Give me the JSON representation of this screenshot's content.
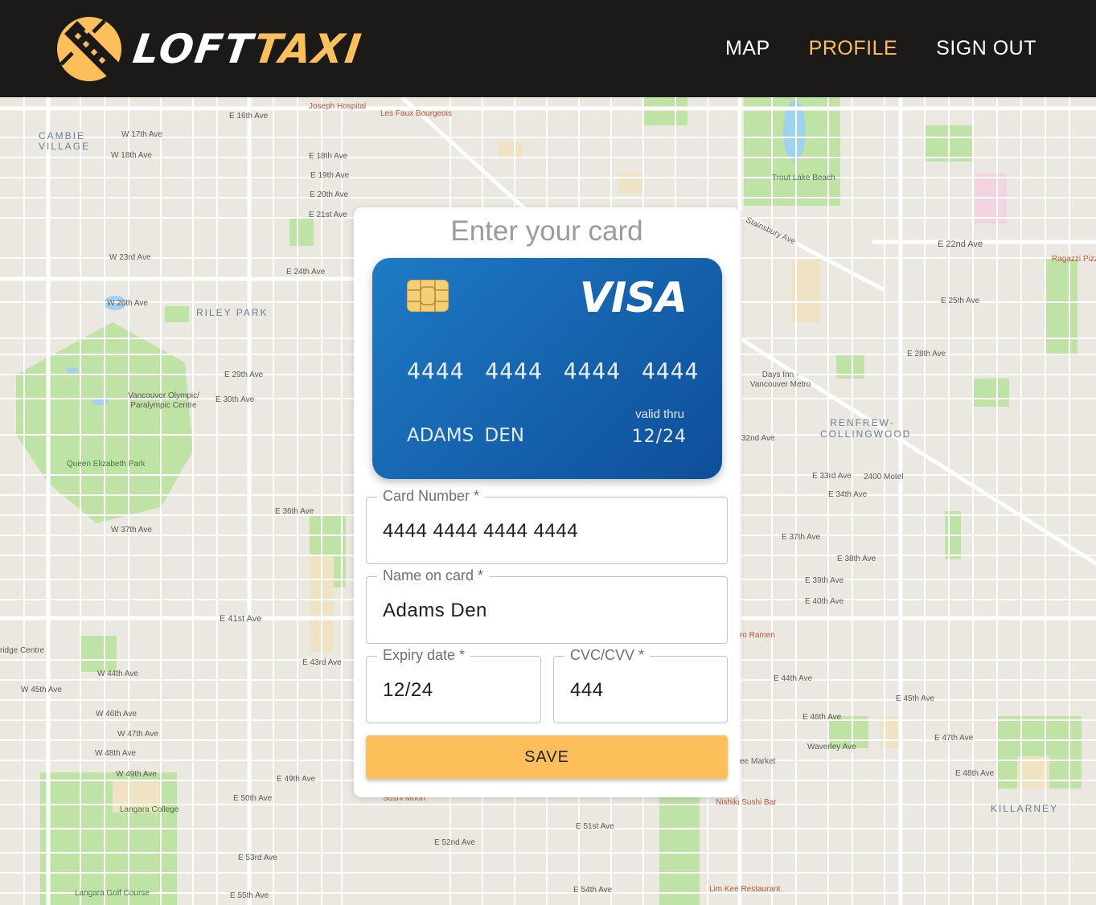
{
  "brand": {
    "text_white": "LOFT",
    "text_yellow": "TAXI",
    "accent": "#fdbf5a"
  },
  "nav": [
    {
      "label": "MAP",
      "active": false
    },
    {
      "label": "PROFILE",
      "active": true
    },
    {
      "label": "SIGN OUT",
      "active": false
    }
  ],
  "map": {
    "labels": [
      {
        "text": "CAMBIE VILLAGE",
        "kind": "district"
      },
      {
        "text": "RILEY PARK",
        "kind": "district"
      },
      {
        "text": "RENFREW-COLLINGWOOD",
        "kind": "district"
      },
      {
        "text": "KILLARNEY",
        "kind": "district"
      },
      {
        "text": "Queen Elizabeth Park",
        "kind": "park"
      },
      {
        "text": "Trout Lake Beach",
        "kind": "park"
      },
      {
        "text": "Langara College",
        "kind": "park"
      },
      {
        "text": "Langara Golf Course",
        "kind": "park"
      },
      {
        "text": "Vancouver Olympic/ Paralympic Centre",
        "kind": "poi"
      },
      {
        "text": "Les Faux Bourgeois",
        "kind": "poi"
      },
      {
        "text": "Joseph Hospital",
        "kind": "poi"
      },
      {
        "text": "Ragazzi Pizz",
        "kind": "poi"
      },
      {
        "text": "Nishiki Sushi Bar",
        "kind": "poi"
      },
      {
        "text": "Lim Kee Restaurant",
        "kind": "poi"
      },
      {
        "text": "Sushi Moon",
        "kind": "poi"
      },
      {
        "text": "ro Ramen",
        "kind": "poi"
      },
      {
        "text": "ee Market",
        "kind": "street"
      },
      {
        "text": "Days Inn - Vancouver Metro",
        "kind": "street"
      },
      {
        "text": "2400 Motel",
        "kind": "street"
      },
      {
        "text": "ridge Centre",
        "kind": "street"
      },
      {
        "text": "E 16th Ave",
        "kind": "street"
      },
      {
        "text": "W 17th Ave",
        "kind": "street"
      },
      {
        "text": "W 18th Ave",
        "kind": "street"
      },
      {
        "text": "E 18th Ave",
        "kind": "street"
      },
      {
        "text": "E 19th Ave",
        "kind": "street"
      },
      {
        "text": "E 20th Ave",
        "kind": "street"
      },
      {
        "text": "E 21st Ave",
        "kind": "street"
      },
      {
        "text": "W 23rd Ave",
        "kind": "street"
      },
      {
        "text": "E 24th Ave",
        "kind": "street"
      },
      {
        "text": "W 26th Ave",
        "kind": "street"
      },
      {
        "text": "E 29th Ave",
        "kind": "street"
      },
      {
        "text": "E 30th Ave",
        "kind": "street"
      },
      {
        "text": "E 22nd Ave",
        "kind": "street"
      },
      {
        "text": "E 25th Ave",
        "kind": "street"
      },
      {
        "text": "E 28th Ave",
        "kind": "street"
      },
      {
        "text": "32nd Ave",
        "kind": "street"
      },
      {
        "text": "E 33rd Ave",
        "kind": "street"
      },
      {
        "text": "E 34th Ave",
        "kind": "street"
      },
      {
        "text": "E 36th Ave",
        "kind": "street"
      },
      {
        "text": "W 37th Ave",
        "kind": "street"
      },
      {
        "text": "E 37th Ave",
        "kind": "street"
      },
      {
        "text": "E 38th Ave",
        "kind": "street"
      },
      {
        "text": "E 39th Ave",
        "kind": "street"
      },
      {
        "text": "E 40th Ave",
        "kind": "street"
      },
      {
        "text": "E 41st Ave",
        "kind": "street"
      },
      {
        "text": "E 43rd Ave",
        "kind": "street"
      },
      {
        "text": "W 44th Ave",
        "kind": "street"
      },
      {
        "text": "E 44th Ave",
        "kind": "street"
      },
      {
        "text": "W 45th Ave",
        "kind": "street"
      },
      {
        "text": "E 45th Ave",
        "kind": "street"
      },
      {
        "text": "W 46th Ave",
        "kind": "street"
      },
      {
        "text": "E 46th Ave",
        "kind": "street"
      },
      {
        "text": "W 47th Ave",
        "kind": "street"
      },
      {
        "text": "E 47th Ave",
        "kind": "street"
      },
      {
        "text": "W 48th Ave",
        "kind": "street"
      },
      {
        "text": "E 48th Ave",
        "kind": "street"
      },
      {
        "text": "W 49th Ave",
        "kind": "street"
      },
      {
        "text": "E 49th Ave",
        "kind": "street"
      },
      {
        "text": "E 50th Ave",
        "kind": "street"
      },
      {
        "text": "E 51st Ave",
        "kind": "street"
      },
      {
        "text": "E 52nd Ave",
        "kind": "street"
      },
      {
        "text": "E 53rd Ave",
        "kind": "street"
      },
      {
        "text": "E 54th Ave",
        "kind": "street"
      },
      {
        "text": "E 55th Ave",
        "kind": "street"
      },
      {
        "text": "Waverley Ave",
        "kind": "street"
      },
      {
        "text": "Stainsbury Ave",
        "kind": "street"
      }
    ]
  },
  "form": {
    "title": "Enter your card",
    "card_preview": {
      "brand": "VISA",
      "number": "4444 4444 4444 4444",
      "holder": "ADAMS  DEN",
      "valid_label": "valid thru",
      "expiry": "12/24"
    },
    "fields": {
      "card_number": {
        "label": "Card Number *",
        "value": "4444 4444 4444 4444"
      },
      "name": {
        "label": "Name on card *",
        "value": "Adams Den"
      },
      "expiry": {
        "label": "Expiry date *",
        "value": "12/24"
      },
      "cvc": {
        "label": "CVC/CVV *",
        "value": "444"
      }
    },
    "save_label": "SAVE"
  }
}
